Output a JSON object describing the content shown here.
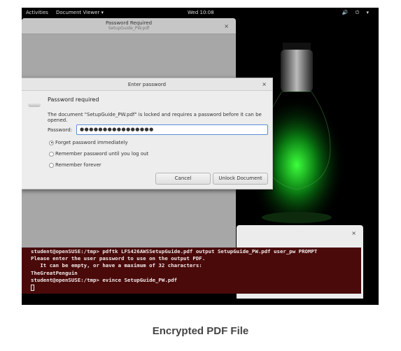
{
  "topbar": {
    "activities": "Activities",
    "app_menu": "Document Viewer ▾",
    "clock": "Wed 10:08",
    "system": "🔊 ⏻ ▾"
  },
  "back_window": {
    "title": "Password Required",
    "subtitle": "SetupGuide_PW.pdf",
    "close": "×"
  },
  "dialog": {
    "title": "Enter password",
    "close": "×",
    "heading": "Password required",
    "message": "The document \"SetupGuide_PW.pdf\" is locked and requires a password before it can be opened.",
    "password_label": "Password:",
    "password_value": "●●●●●●●●●●●●●●●●",
    "options": [
      {
        "label": "Forget password immediately",
        "selected": true
      },
      {
        "label": "Remember password until you log out",
        "selected": false
      },
      {
        "label": "Remember forever",
        "selected": false
      }
    ],
    "cancel": "Cancel",
    "unlock": "Unlock Document"
  },
  "terminal": {
    "close": "×",
    "lines": [
      "student@openSUSE:/tmp> pdftk LFS426AWSSetupGuide.pdf output SetupGuide_PW.pdf user_pw PROMPT",
      "Please enter the user password to use on the output PDF.",
      "   It can be empty, or have a maximum of 32 characters:",
      "TheGreatPenguin",
      "student@openSUSE:/tmp> evince SetupGuide_PW.pdf"
    ]
  },
  "caption": "Encrypted PDF File"
}
